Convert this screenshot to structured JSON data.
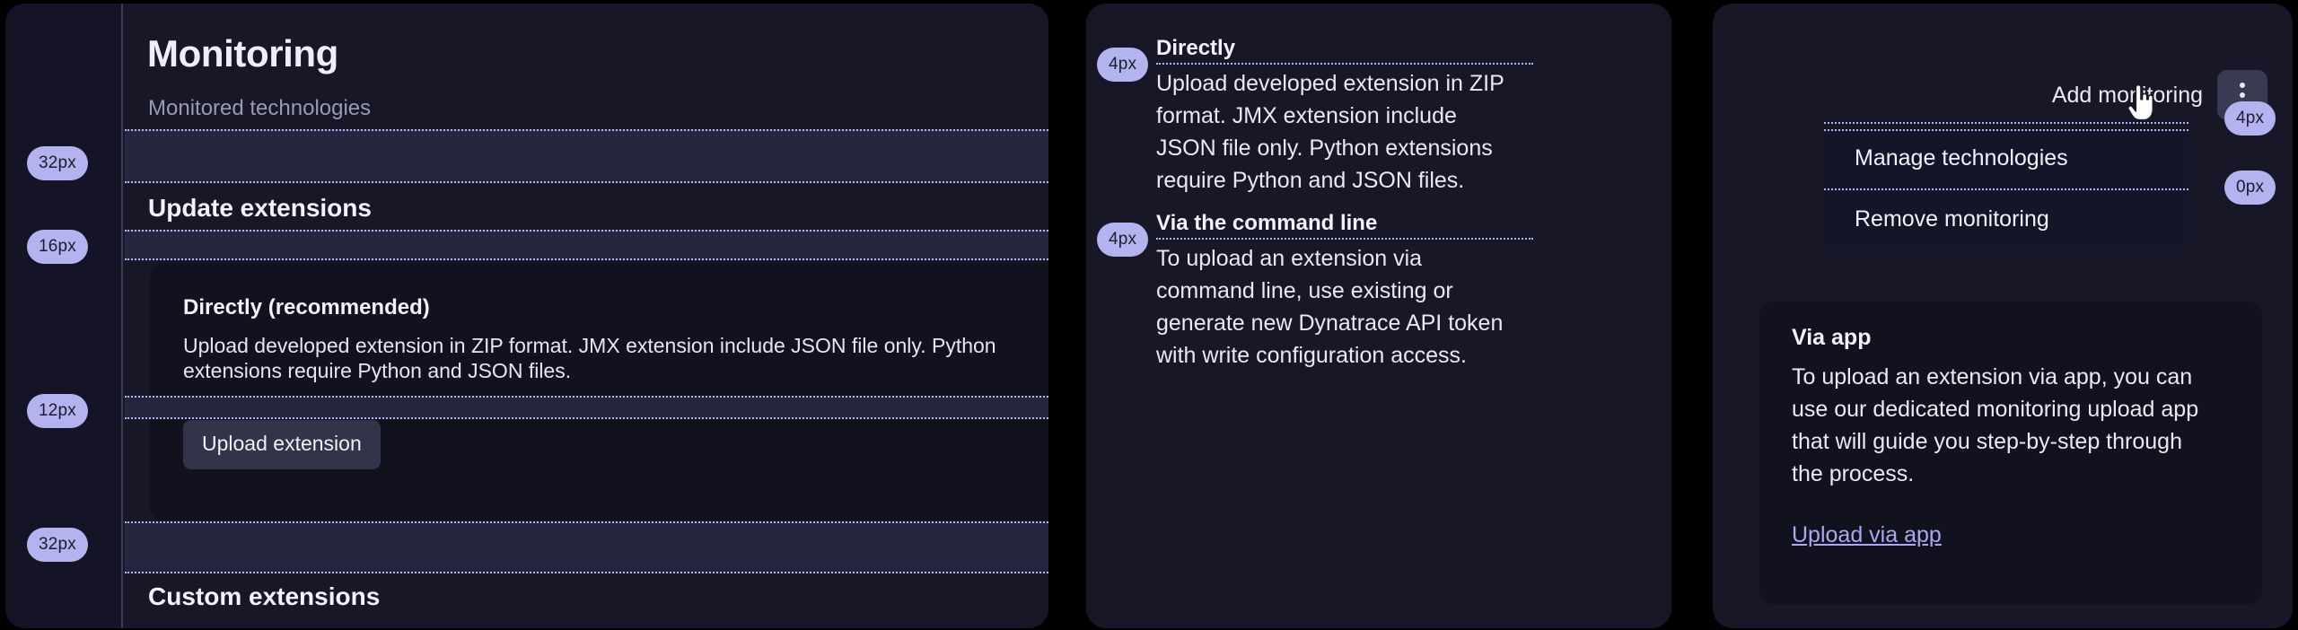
{
  "panel_one": {
    "title": "Monitoring",
    "subtitle": "Monitored technologies",
    "section_heading": "Update extensions",
    "section_heading_bottom": "Custom extensions",
    "card": {
      "title": "Directly (recommended)",
      "body": "Upload developed extension in ZIP format. JMX extension include JSON file only. Python extensions require Python and JSON files.",
      "button_label": "Upload extension"
    },
    "spacing_badges": [
      {
        "value": "32px"
      },
      {
        "value": "16px"
      },
      {
        "value": "12px"
      },
      {
        "value": "32px"
      }
    ]
  },
  "panel_two": {
    "blocks": [
      {
        "badge": "4px",
        "heading": "Directly",
        "body": "Upload developed extension in ZIP format. JMX extension include JSON file only. Python extensions require Python and JSON files."
      },
      {
        "badge": "4px",
        "heading": "Via the command line",
        "body": "To upload an extension via command line, use existing or generate new Dynatrace API token with write configuration access."
      }
    ]
  },
  "panel_three": {
    "add_monitoring_label": "Add monitoring",
    "kebab_icon": "more-vertical-icon",
    "cursor_icon": "pointer-hand-cursor",
    "menu": {
      "items": [
        {
          "label": "Manage technologies"
        },
        {
          "label": "Remove monitoring"
        }
      ]
    },
    "spacing_badges": [
      {
        "value": "4px"
      },
      {
        "value": "0px"
      }
    ],
    "card": {
      "title": "Via app",
      "body": "To upload an extension via app, you can use our dedicated monitoring upload app that will guide you step-by-step through the process.",
      "link_label": "Upload via app"
    }
  },
  "colors": {
    "badge_bg": "#b3b3f0",
    "badge_text": "#1c1c2e",
    "guide_line": "#b6b6f2",
    "gap_band": "#262640",
    "panel_bg": "#171727",
    "card_bg": "#12121f",
    "link": "#a9a9ef",
    "canvas": "#000000"
  }
}
